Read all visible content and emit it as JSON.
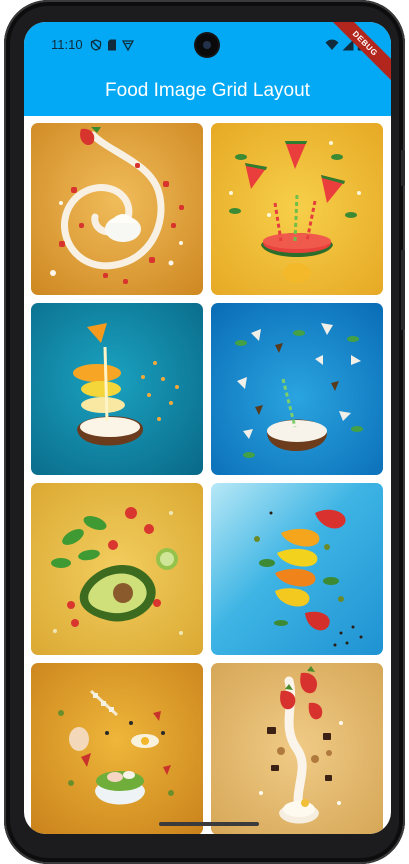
{
  "status_bar": {
    "time": "11:10"
  },
  "app_bar": {
    "title": "Food Image Grid Layout"
  },
  "debug_banner": "DEBUG",
  "grid": {
    "tiles": [
      {
        "subject": "strawberry cream swirl",
        "bg": "#e3a33a"
      },
      {
        "subject": "watermelon slices with straws",
        "bg": "#eebd33"
      },
      {
        "subject": "coconut with citrus stack",
        "bg": "#128aa8"
      },
      {
        "subject": "coconut smoothie splash",
        "bg": "#1283c9"
      },
      {
        "subject": "avocado basil tomato salad",
        "bg": "#e7bd45"
      },
      {
        "subject": "floating bell peppers",
        "bg": "#33aee0"
      },
      {
        "subject": "egg salad bowl ingredients",
        "bg": "#de9a1e"
      },
      {
        "subject": "strawberries with cream and cookies",
        "bg": "#e4bb6e"
      }
    ]
  }
}
